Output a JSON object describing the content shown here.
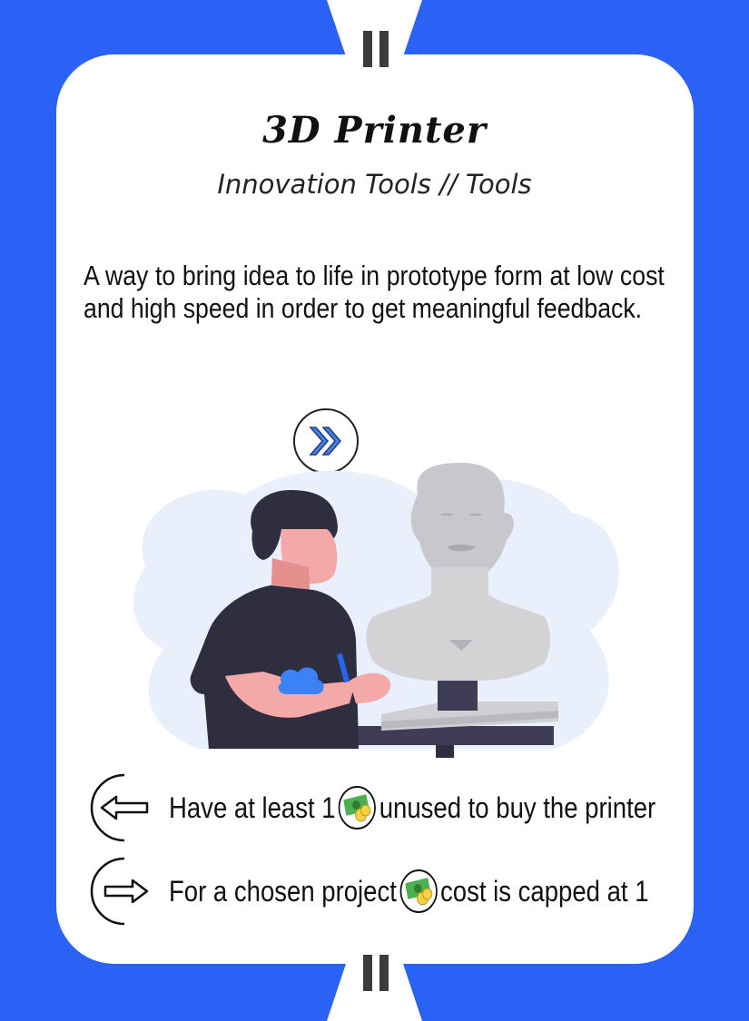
{
  "card": {
    "title": "3D Printer",
    "subtitle": "Innovation Tools // Tools",
    "description": "A way to bring idea to life in prototype form at low cost and high speed in order to get meaningful feedback."
  },
  "rules": [
    {
      "direction": "left",
      "icon": "arrow-left-icon",
      "before": "Have at least 1",
      "resource_icon": "money-icon",
      "after": "unused to buy the printer"
    },
    {
      "direction": "right",
      "icon": "arrow-right-icon",
      "before": "For a chosen project",
      "resource_icon": "money-icon",
      "after": "cost is capped at 1"
    }
  ],
  "colors": {
    "background": "#2a62f5",
    "card": "#ffffff",
    "accent": "#4a7fd6"
  }
}
